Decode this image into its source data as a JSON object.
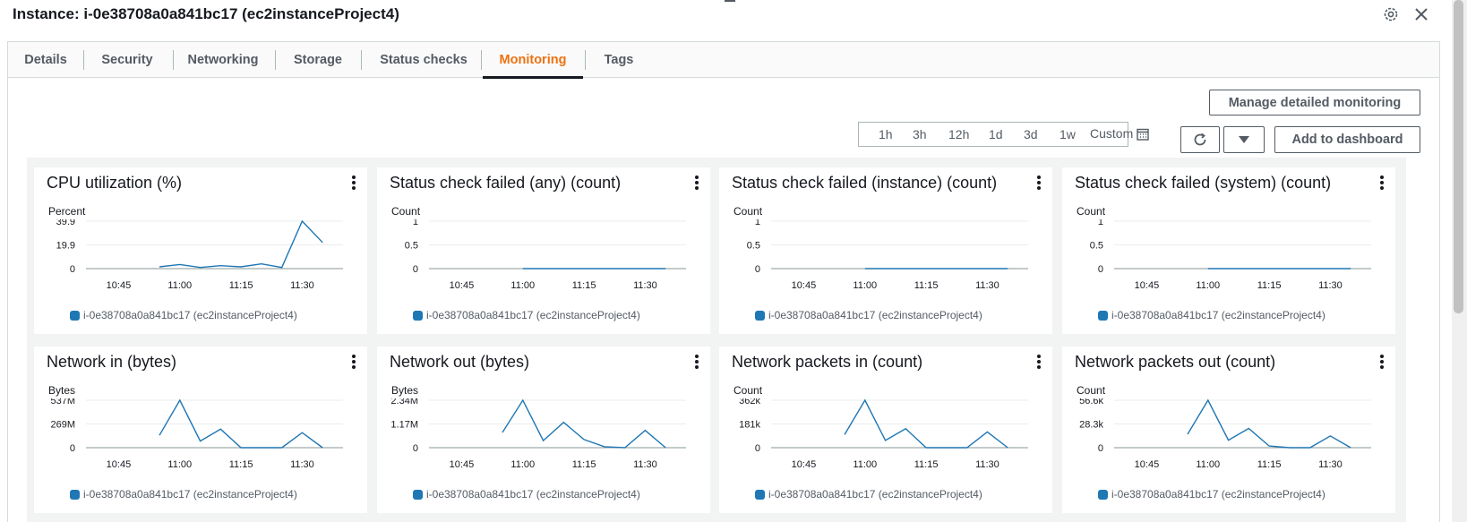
{
  "header": {
    "title": "Instance: i-0e38708a0a841bc17 (ec2instanceProject4)",
    "gear_icon": "gear-icon",
    "close_icon": "close-icon"
  },
  "tabs": [
    {
      "label": "Details"
    },
    {
      "label": "Security"
    },
    {
      "label": "Networking"
    },
    {
      "label": "Storage"
    },
    {
      "label": "Status checks"
    },
    {
      "label": "Monitoring",
      "active": true
    },
    {
      "label": "Tags"
    }
  ],
  "toolbar": {
    "manage_label": "Manage detailed monitoring",
    "ranges": [
      "1h",
      "3h",
      "12h",
      "1d",
      "3d",
      "1w"
    ],
    "custom_label": "Custom",
    "refresh_icon": "refresh-icon",
    "dropdown_icon": "caret-down-icon",
    "add_label": "Add to dashboard"
  },
  "colors": {
    "series": "#1f77b4",
    "active_tab": "#ec7211"
  },
  "legend_label": "i-0e38708a0a841bc17 (ec2instanceProject4)",
  "chart_data": [
    {
      "type": "line",
      "title": "CPU utilization (%)",
      "ylabel": "Percent",
      "ylim": [
        0,
        39.9
      ],
      "yticks": [
        "0",
        "19.9",
        "39.9"
      ],
      "xticks": [
        "10:45",
        "11:00",
        "11:15",
        "11:30"
      ],
      "series": [
        {
          "name": "i-0e38708a0a841bc17 (ec2instanceProject4)",
          "x": [
            "10:55",
            "11:00",
            "11:05",
            "11:10",
            "11:15",
            "11:20",
            "11:25",
            "11:30",
            "11:35"
          ],
          "values": [
            1.5,
            3.5,
            1.0,
            2.5,
            1.5,
            4.0,
            1.0,
            39.9,
            22.0
          ]
        }
      ]
    },
    {
      "type": "line",
      "title": "Status check failed (any) (count)",
      "ylabel": "Count",
      "ylim": [
        0,
        1
      ],
      "yticks": [
        "0",
        "0.5",
        "1"
      ],
      "xticks": [
        "10:45",
        "11:00",
        "11:15",
        "11:30"
      ],
      "series": [
        {
          "name": "i-0e38708a0a841bc17 (ec2instanceProject4)",
          "x": [
            "11:00",
            "11:35"
          ],
          "values": [
            0,
            0
          ]
        }
      ]
    },
    {
      "type": "line",
      "title": "Status check failed (instance) (count)",
      "ylabel": "Count",
      "ylim": [
        0,
        1
      ],
      "yticks": [
        "0",
        "0.5",
        "1"
      ],
      "xticks": [
        "10:45",
        "11:00",
        "11:15",
        "11:30"
      ],
      "series": [
        {
          "name": "i-0e38708a0a841bc17 (ec2instanceProject4)",
          "x": [
            "11:00",
            "11:35"
          ],
          "values": [
            0,
            0
          ]
        }
      ]
    },
    {
      "type": "line",
      "title": "Status check failed (system) (count)",
      "ylabel": "Count",
      "ylim": [
        0,
        1
      ],
      "yticks": [
        "0",
        "0.5",
        "1"
      ],
      "xticks": [
        "10:45",
        "11:00",
        "11:15",
        "11:30"
      ],
      "series": [
        {
          "name": "i-0e38708a0a841bc17 (ec2instanceProject4)",
          "x": [
            "11:00",
            "11:35"
          ],
          "values": [
            0,
            0
          ]
        }
      ]
    },
    {
      "type": "line",
      "title": "Network in (bytes)",
      "ylabel": "Bytes",
      "ylim": [
        0,
        537
      ],
      "yticks": [
        "0",
        "269M",
        "537M"
      ],
      "xticks": [
        "10:45",
        "11:00",
        "11:15",
        "11:30"
      ],
      "series": [
        {
          "name": "i-0e38708a0a841bc17 (ec2instanceProject4)",
          "x": [
            "10:55",
            "11:00",
            "11:05",
            "11:10",
            "11:15",
            "11:20",
            "11:25",
            "11:30",
            "11:35"
          ],
          "values": [
            140,
            537,
            75,
            210,
            0,
            0,
            0,
            170,
            0
          ]
        }
      ]
    },
    {
      "type": "line",
      "title": "Network out (bytes)",
      "ylabel": "Bytes",
      "ylim": [
        0,
        2.34
      ],
      "yticks": [
        "0",
        "1.17M",
        "2.34M"
      ],
      "xticks": [
        "10:45",
        "11:00",
        "11:15",
        "11:30"
      ],
      "series": [
        {
          "name": "i-0e38708a0a841bc17 (ec2instanceProject4)",
          "x": [
            "10:55",
            "11:00",
            "11:05",
            "11:10",
            "11:15",
            "11:20",
            "11:25",
            "11:30",
            "11:35"
          ],
          "values": [
            0.75,
            2.34,
            0.35,
            1.25,
            0.4,
            0.05,
            0,
            0.85,
            0
          ]
        }
      ]
    },
    {
      "type": "line",
      "title": "Network packets in (count)",
      "ylabel": "Count",
      "ylim": [
        0,
        362
      ],
      "yticks": [
        "0",
        "181k",
        "362k"
      ],
      "xticks": [
        "10:45",
        "11:00",
        "11:15",
        "11:30"
      ],
      "series": [
        {
          "name": "i-0e38708a0a841bc17 (ec2instanceProject4)",
          "x": [
            "10:55",
            "11:00",
            "11:05",
            "11:10",
            "11:15",
            "11:20",
            "11:25",
            "11:30",
            "11:35"
          ],
          "values": [
            100,
            362,
            55,
            145,
            0,
            0,
            0,
            120,
            0
          ]
        }
      ]
    },
    {
      "type": "line",
      "title": "Network packets out (count)",
      "ylabel": "Count",
      "ylim": [
        0,
        56.6
      ],
      "yticks": [
        "0",
        "28.3k",
        "56.6k"
      ],
      "xticks": [
        "10:45",
        "11:00",
        "11:15",
        "11:30"
      ],
      "series": [
        {
          "name": "i-0e38708a0a841bc17 (ec2instanceProject4)",
          "x": [
            "10:55",
            "11:00",
            "11:05",
            "11:10",
            "11:15",
            "11:20",
            "11:25",
            "11:30",
            "11:35"
          ],
          "values": [
            16,
            56.6,
            9,
            23,
            2,
            0,
            0,
            14,
            0
          ]
        }
      ]
    }
  ]
}
